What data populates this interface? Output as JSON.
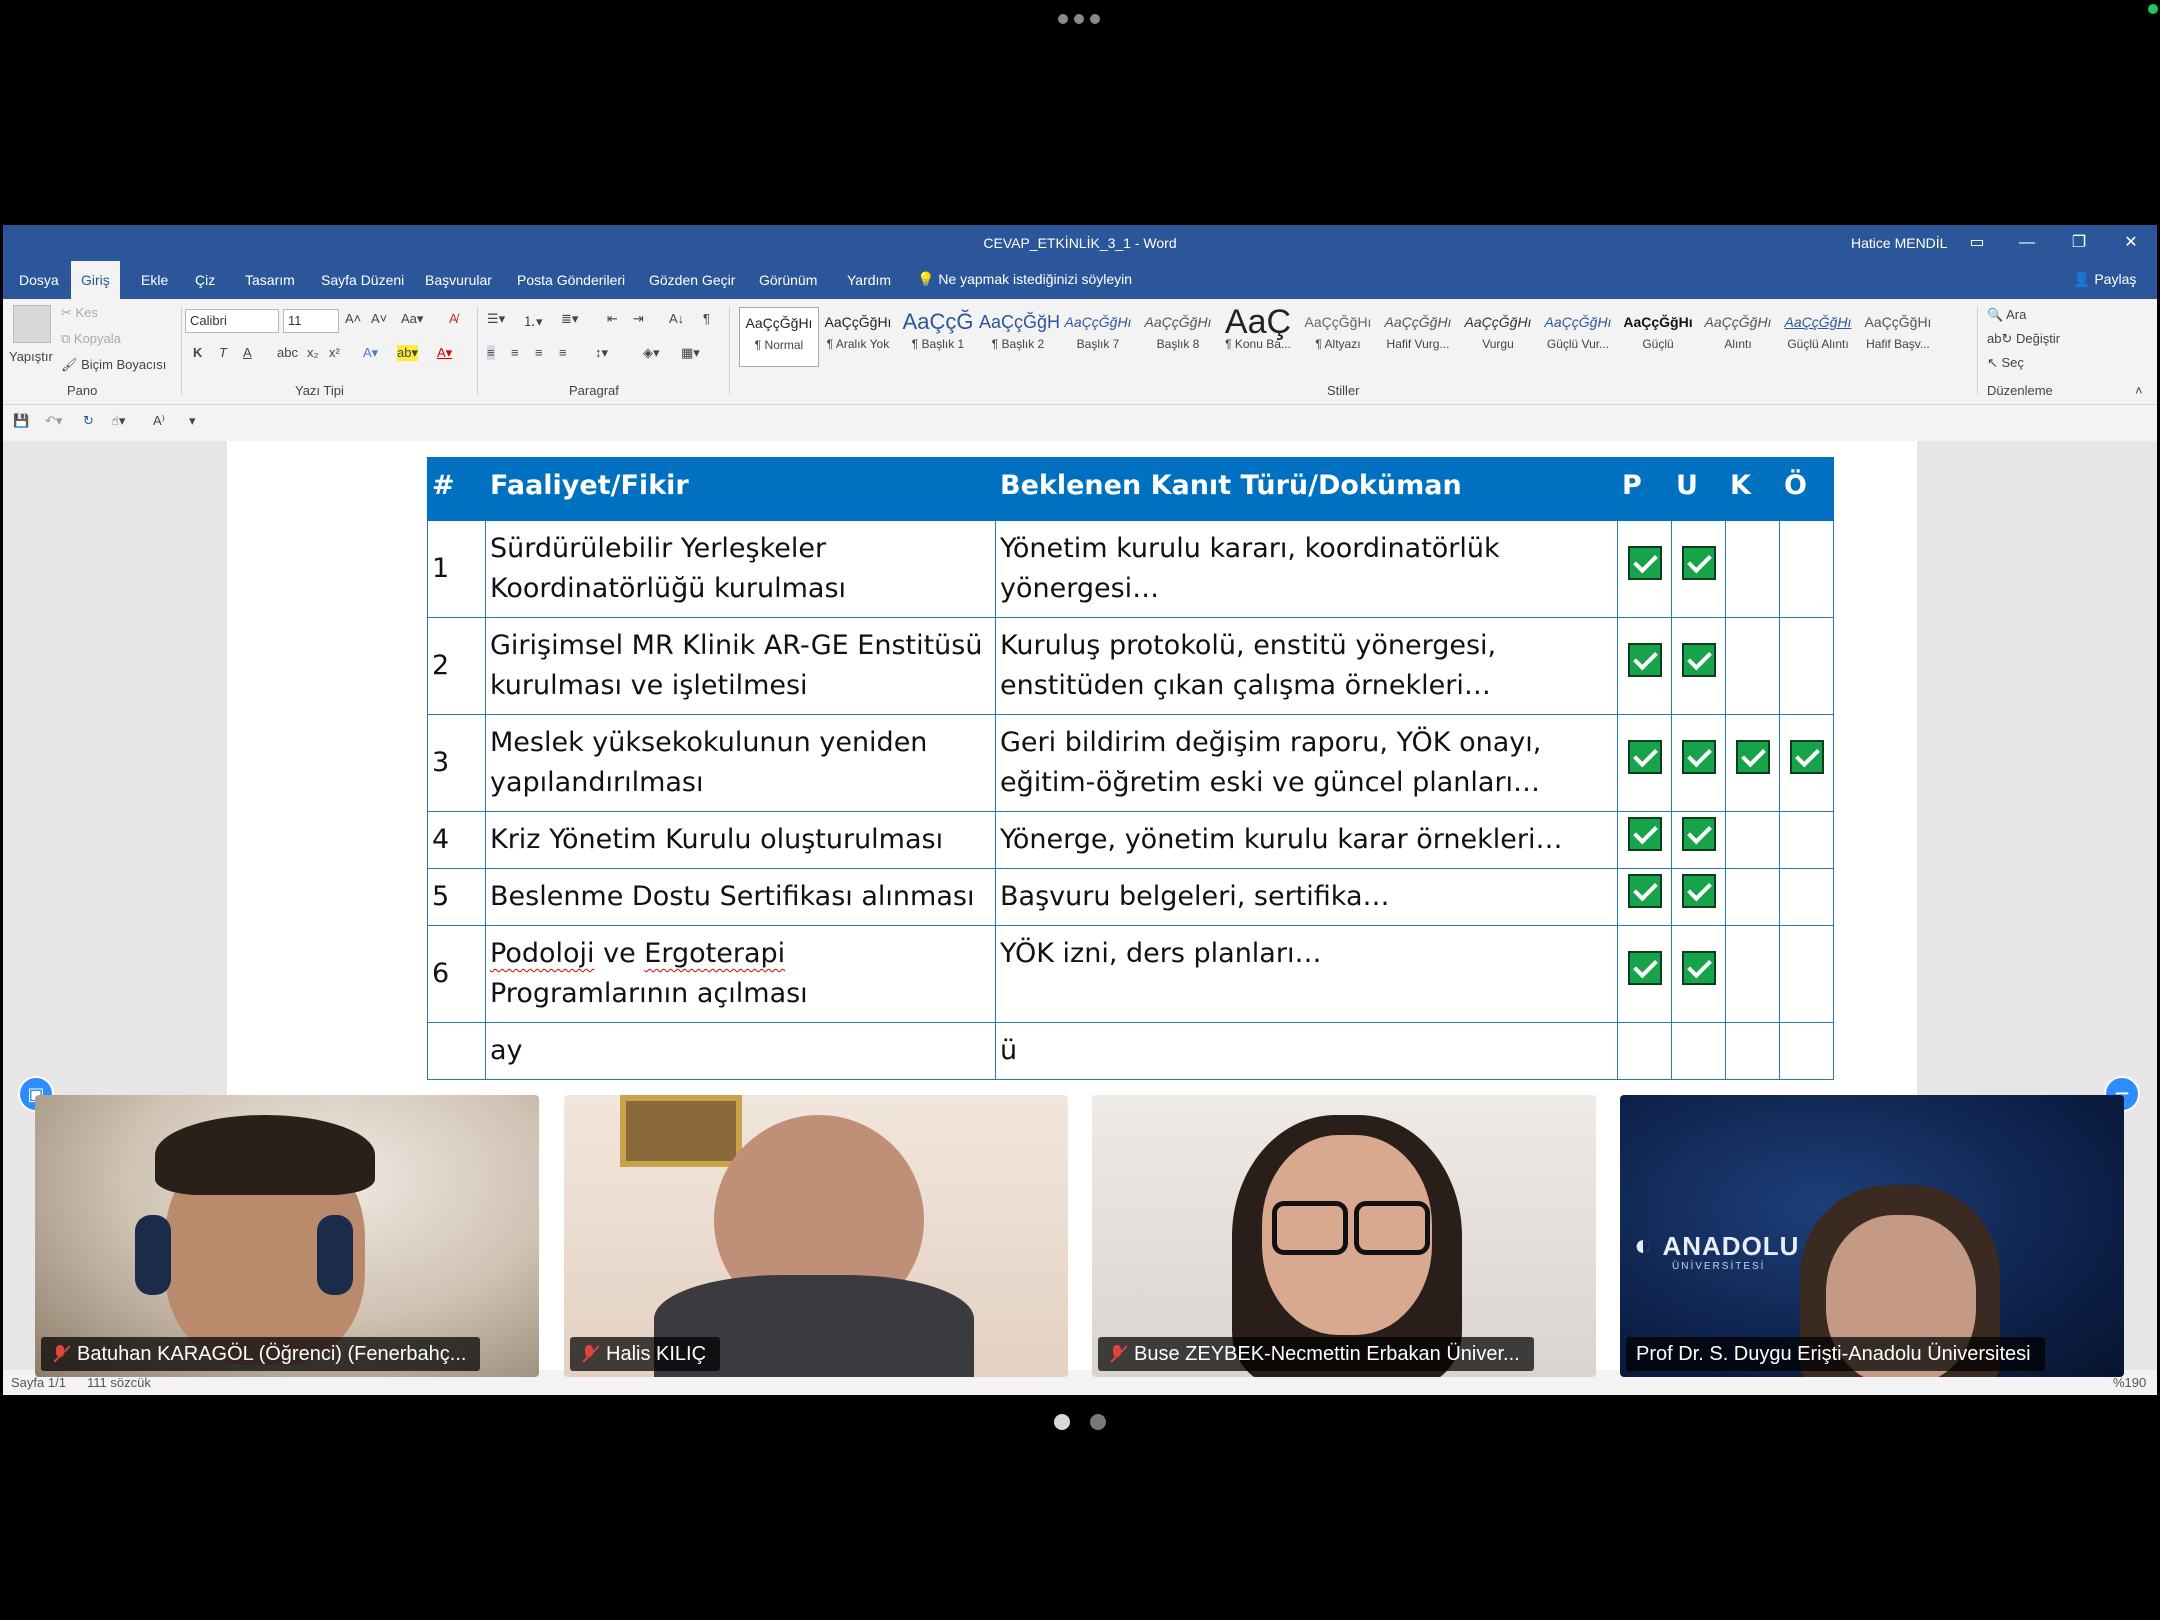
{
  "word": {
    "doc_title": "CEVAP_ETKİNLİK_3_1  -  Word",
    "user": "Hatice MENDİL",
    "tabs": [
      "Dosya",
      "Giriş",
      "Ekle",
      "Çiz",
      "Tasarım",
      "Sayfa Düzeni",
      "Başvurular",
      "Posta Gönderileri",
      "Gözden Geçir",
      "Görünüm",
      "Yardım"
    ],
    "active_tab": "Giriş",
    "tell_me": "Ne yapmak istediğinizi söyleyin",
    "share": "Paylaş",
    "clipboard": {
      "paste": "Yapıştır",
      "cut": "Kes",
      "copy": "Kopyala",
      "format_painter": "Biçim Boyacısı",
      "group": "Pano"
    },
    "font": {
      "name": "Calibri",
      "size": "11",
      "group": "Yazı Tipi",
      "bold": "K",
      "italic": "T",
      "underline": "A"
    },
    "paragraph_group": "Paragraf",
    "styles_group": "Stiller",
    "styles": [
      {
        "sample": "AaÇçĞğHı",
        "name": "¶ Normal"
      },
      {
        "sample": "AaÇçĞğHı",
        "name": "¶ Aralık Yok"
      },
      {
        "sample": "AaÇçĞ",
        "name": "¶ Başlık 1"
      },
      {
        "sample": "AaÇçĞğH",
        "name": "¶ Başlık 2"
      },
      {
        "sample": "AaÇçĞğHı",
        "name": "Başlık 7"
      },
      {
        "sample": "AaÇçĞğHı",
        "name": "Başlık 8"
      },
      {
        "sample": "AaÇ",
        "name": "¶ Konu Ba..."
      },
      {
        "sample": "AaÇçĞğHı",
        "name": "¶ Altyazı"
      },
      {
        "sample": "AaÇçĞğHı",
        "name": "Hafif Vurg..."
      },
      {
        "sample": "AaÇçĞğHı",
        "name": "Vurgu"
      },
      {
        "sample": "AaÇçĞğHı",
        "name": "Güçlü Vur..."
      },
      {
        "sample": "AaÇçĞğHı",
        "name": "Güçlü"
      },
      {
        "sample": "AaÇçĞğHı",
        "name": "Alıntı"
      },
      {
        "sample": "AaÇçĞğHı",
        "name": "Güçlü Alıntı"
      },
      {
        "sample": "AaÇçĞğHı",
        "name": "Hafif Başv..."
      }
    ],
    "editing": {
      "find": "Ara",
      "replace": "Değiştir",
      "select": "Seç",
      "group": "Düzenleme"
    },
    "status": {
      "page": "Sayfa 1/1",
      "words": "111 sözcük",
      "zoom": "%190"
    }
  },
  "table": {
    "headers": [
      "#",
      "Faaliyet/Fikir",
      "Beklenen Kanıt Türü/Doküman",
      "P",
      "U",
      "K",
      "Ö"
    ],
    "rows": [
      {
        "num": "1",
        "activity": "Sürdürülebilir Yerleşkeler Koordinatörlüğü kurulması",
        "evidence": "Yönetim kurulu kararı, koordinatörlük yönergesi…",
        "checks": [
          true,
          true,
          false,
          false
        ]
      },
      {
        "num": "2",
        "activity": "Girişimsel MR Klinik AR-GE Enstitüsü kurulması ve işletilmesi",
        "evidence": "Kuruluş protokolü, enstitü yönergesi, enstitüden çıkan çalışma örnekleri…",
        "checks": [
          true,
          true,
          false,
          false
        ]
      },
      {
        "num": "3",
        "activity": "Meslek yüksekokulunun yeniden yapılandırılması",
        "evidence": "Geri bildirim değişim raporu, YÖK onayı, eğitim-öğretim eski ve güncel planları…",
        "checks": [
          true,
          true,
          true,
          true
        ]
      },
      {
        "num": "4",
        "activity": "Kriz Yönetim Kurulu oluşturulması",
        "evidence": "Yönerge, yönetim kurulu karar örnekleri…",
        "checks": [
          true,
          true,
          false,
          false
        ]
      },
      {
        "num": "5",
        "activity": "Beslenme Dostu Sertifikası alınması",
        "evidence": "Başvuru belgeleri, sertifika…",
        "checks": [
          true,
          true,
          false,
          false
        ]
      },
      {
        "num": "6",
        "activity_parts": [
          "Podoloji",
          " ve ",
          "Ergoterapi",
          " Programlarının açılması"
        ],
        "evidence": "YÖK izni, ders planları…",
        "checks": [
          true,
          true,
          false,
          false
        ]
      }
    ],
    "partial_row": {
      "activity_fragment": "ay",
      "evidence_fragment": "ü"
    }
  },
  "participants": [
    {
      "name": "Batuhan KARAGÖL (Öğrenci) (Fenerbahç...",
      "muted": true
    },
    {
      "name": "Halis KILIÇ",
      "muted": true
    },
    {
      "name": "Buse ZEYBEK-Necmettin Erbakan Üniver...",
      "muted": true
    },
    {
      "name": "Prof Dr. S. Duygu Erişti-Anadolu Üniversitesi",
      "muted": false
    }
  ],
  "logo_text": "ANADOLU",
  "logo_sub": "ÜNİVERSİTESİ",
  "colors": {
    "word_blue": "#2b579a",
    "table_header": "#0070c0",
    "check_green": "#16a34a"
  }
}
